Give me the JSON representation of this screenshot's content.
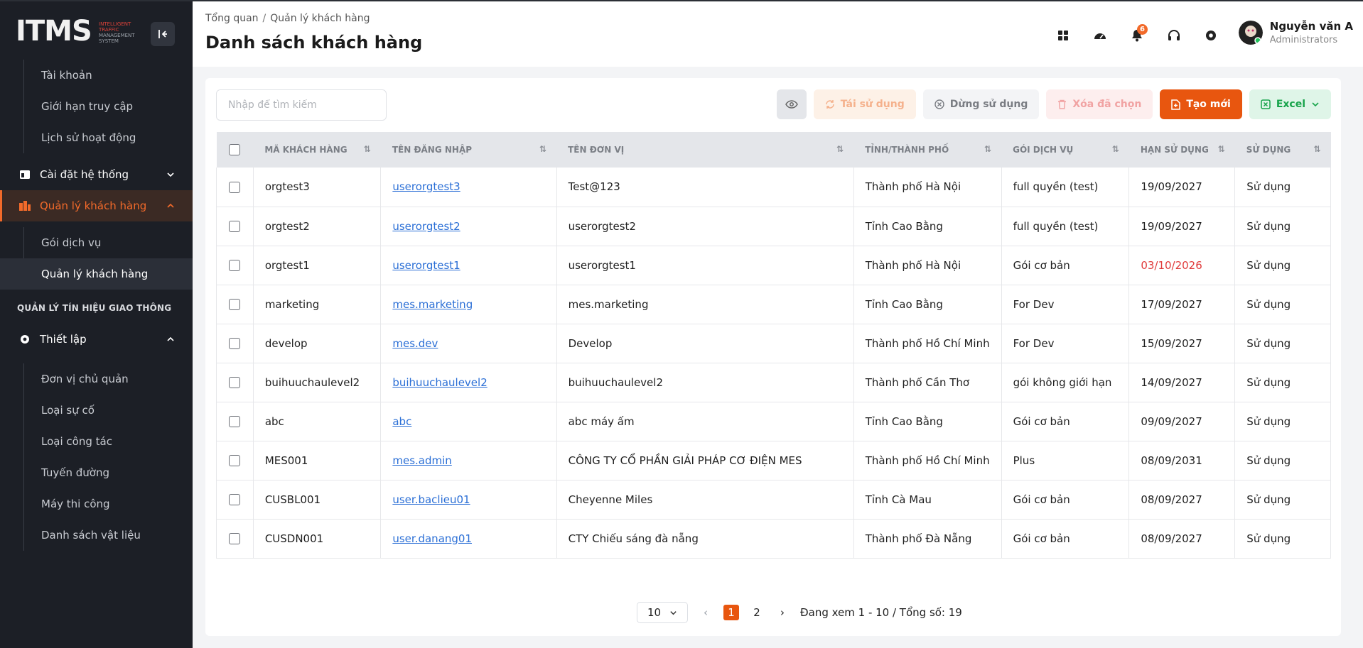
{
  "sidebar": {
    "logo_text": "ITMS",
    "logo_sub1": "INTELLIGENT",
    "logo_sub2": "TRAFFIC",
    "logo_sub3": "MANAGEMENT",
    "logo_sub4": "SYSTEM",
    "top_items": [
      "Tài khoản",
      "Giới hạn truy cập",
      "Lịch sử hoạt động"
    ],
    "group_settings": "Cài đặt hệ thống",
    "group_customers": "Quản lý khách hàng",
    "customer_items": [
      "Gói dịch vụ",
      "Quản lý khách hàng"
    ],
    "section_signal": "QUẢN LÝ TÍN HIỆU GIAO THÔNG",
    "group_setup": "Thiết lập",
    "setup_items": [
      "Đơn vị chủ quản",
      "Loại sự cố",
      "Loại công tác",
      "Tuyến đường",
      "Máy thi công",
      "Danh sách vật liệu"
    ]
  },
  "header": {
    "breadcrumb": [
      "Tổng quan",
      "Quản lý khách hàng"
    ],
    "title": "Danh sách khách hàng",
    "notification_count": "6",
    "user_name": "Nguyễn văn A",
    "user_role": "Administrators"
  },
  "toolbar": {
    "search_placeholder": "Nhập để tìm kiếm",
    "reuse": "Tái sử dụng",
    "stop": "Dừng sử dụng",
    "delete_selected": "Xóa đã chọn",
    "create": "Tạo mới",
    "excel": "Excel"
  },
  "table": {
    "columns": [
      "MÃ KHÁCH HÀNG",
      "TÊN ĐĂNG NHẬP",
      "TÊN ĐƠN VỊ",
      "TỈNH/THÀNH PHỐ",
      "GÓI DỊCH VỤ",
      "HẠN SỬ DỤNG",
      "SỬ DỤNG"
    ],
    "rows": [
      {
        "code": "orgtest3",
        "username": "userorgtest3",
        "unit": "Test@123",
        "province": "Thành phố Hà Nội",
        "plan": "full quyền (test)",
        "expiry": "19/09/2027",
        "status": "Sử dụng"
      },
      {
        "code": "orgtest2",
        "username": "userorgtest2",
        "unit": "userorgtest2",
        "province": "Tỉnh Cao Bằng",
        "plan": "full quyền (test)",
        "expiry": "19/09/2027",
        "status": "Sử dụng"
      },
      {
        "code": "orgtest1",
        "username": "userorgtest1",
        "unit": "userorgtest1",
        "province": "Thành phố Hà Nội",
        "plan": "Gói cơ bản",
        "expiry": "03/10/2026",
        "status": "Sử dụng"
      },
      {
        "code": "marketing",
        "username": "mes.marketing",
        "unit": "mes.marketing",
        "province": "Tỉnh Cao Bằng",
        "plan": "For Dev",
        "expiry": "17/09/2027",
        "status": "Sử dụng"
      },
      {
        "code": "develop",
        "username": "mes.dev",
        "unit": "Develop",
        "province": "Thành phố Hồ Chí Minh",
        "plan": "For Dev",
        "expiry": "15/09/2027",
        "status": "Sử dụng"
      },
      {
        "code": "buihuuchaulevel2",
        "username": "buihuuchaulevel2",
        "unit": "buihuuchaulevel2",
        "province": "Thành phố Cần Thơ",
        "plan": "gói không giới hạn",
        "expiry": "14/09/2027",
        "status": "Sử dụng"
      },
      {
        "code": "abc",
        "username": "abc",
        "unit": "abc máy ấm",
        "province": "Tỉnh Cao Bằng",
        "plan": "Gói cơ bản",
        "expiry": "09/09/2027",
        "status": "Sử dụng"
      },
      {
        "code": "MES001",
        "username": "mes.admin",
        "unit": "CÔNG TY CỔ PHẦN GIẢI PHÁP CƠ ĐIỆN MES",
        "province": "Thành phố Hồ Chí Minh",
        "plan": "Plus",
        "expiry": "08/09/2031",
        "status": "Sử dụng"
      },
      {
        "code": "CUSBL001",
        "username": "user.baclieu01",
        "unit": "Cheyenne Miles",
        "province": "Tỉnh Cà Mau",
        "plan": "Gói cơ bản",
        "expiry": "08/09/2027",
        "status": "Sử dụng"
      },
      {
        "code": "CUSDN001",
        "username": "user.danang01",
        "unit": "CTY Chiếu sáng đà nẵng",
        "province": "Thành phố Đà Nẵng",
        "plan": "Gói cơ bản",
        "expiry": "08/09/2027",
        "status": "Sử dụng"
      }
    ]
  },
  "pagination": {
    "page_size": "10",
    "pages": [
      "1",
      "2"
    ],
    "current": "1",
    "summary": "Đang xem 1 - 10 / Tổng số: 19"
  },
  "colors": {
    "accent": "#e8560f",
    "sidebar_bg": "#1c1f26",
    "expired_soon": "#e03a3a",
    "link": "#2b6fd6"
  }
}
